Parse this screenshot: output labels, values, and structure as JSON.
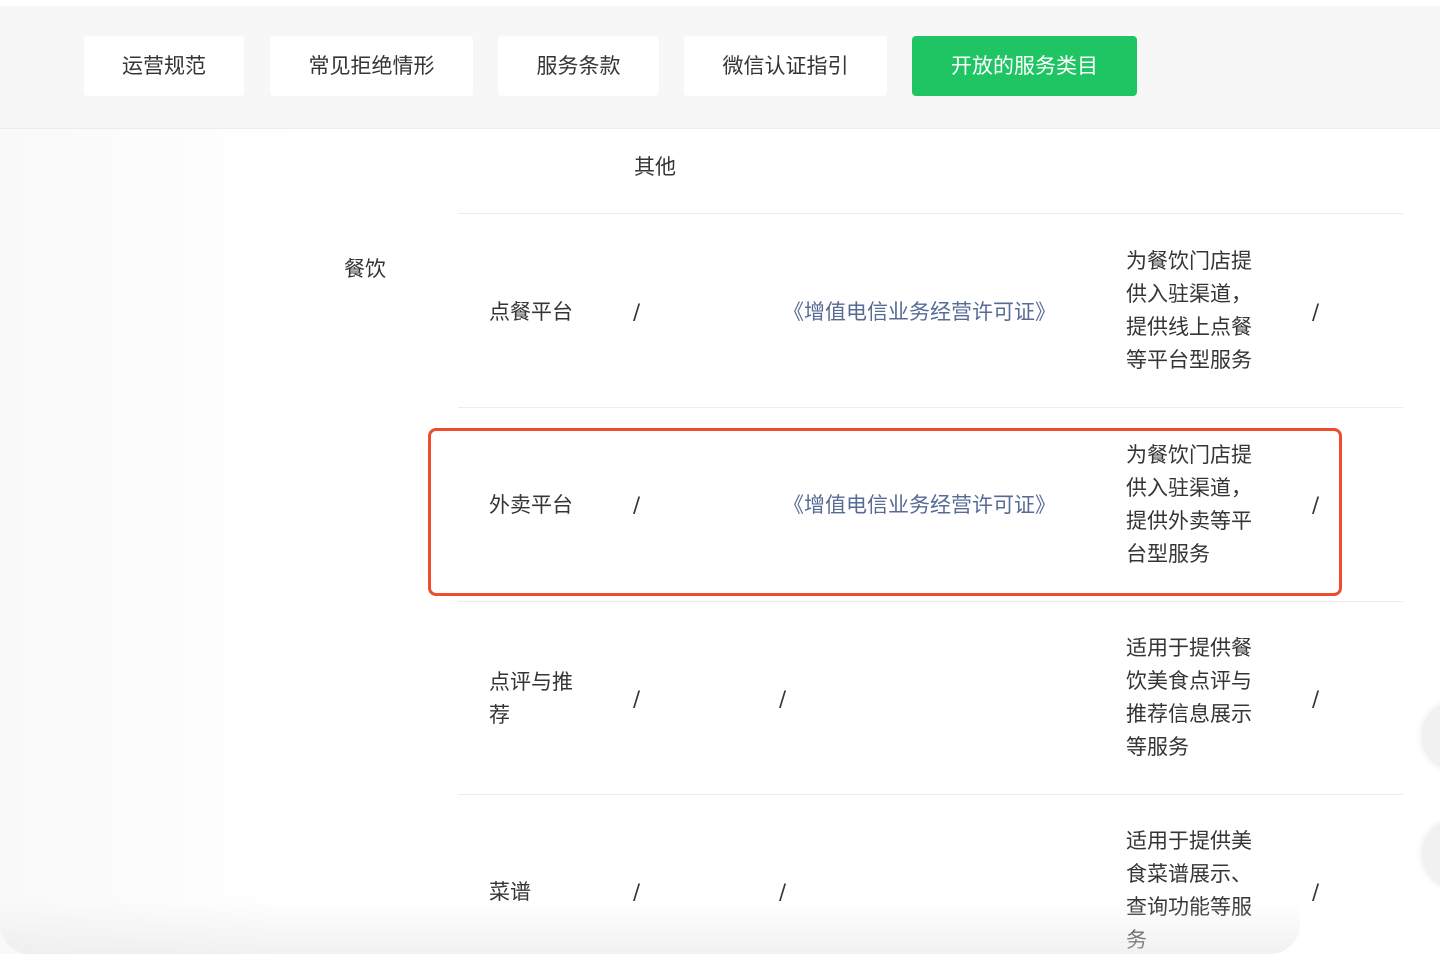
{
  "tabs": [
    {
      "label": "运营规范"
    },
    {
      "label": "常见拒绝情形"
    },
    {
      "label": "服务条款"
    },
    {
      "label": "微信认证指引"
    },
    {
      "label": "开放的服务类目",
      "active": true
    }
  ],
  "table": {
    "partial_header": "其他",
    "category": "餐饮",
    "rows": [
      {
        "name": "点餐平台",
        "col2": "/",
        "license": "《增值电信业务经营许可证》",
        "description": [
          "为餐饮门店提",
          "供入驻渠道，",
          "提供线上点餐",
          "等平台型服务"
        ],
        "col5": "/"
      },
      {
        "name": "外卖平台",
        "col2": "/",
        "license": "《增值电信业务经营许可证》",
        "description": [
          "为餐饮门店提",
          "供入驻渠道，",
          "提供外卖等平",
          "台型服务"
        ],
        "col5": "/",
        "highlighted": true
      },
      {
        "name_lines": [
          "点评与推",
          "荐"
        ],
        "col2": "/",
        "license": "/",
        "description": [
          "适用于提供餐",
          "饮美食点评与",
          "推荐信息展示",
          "等服务"
        ],
        "col5": "/"
      },
      {
        "name": "菜谱",
        "col2": "/",
        "license": "/",
        "description": [
          "适用于提供美",
          "食菜谱展示、",
          "查询功能等服",
          "务"
        ],
        "col5": "/"
      }
    ]
  },
  "colors": {
    "tab_active_bg": "#1fc563",
    "link": "#576b95",
    "highlight_border": "#ee4b2f"
  }
}
